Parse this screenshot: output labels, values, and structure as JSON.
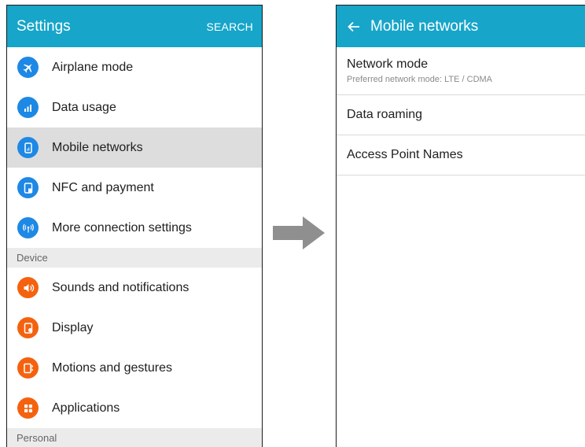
{
  "left_screen": {
    "app_bar": {
      "title": "Settings",
      "search_label": "SEARCH",
      "color": "#17a5c9"
    },
    "items": [
      {
        "label": "Airplane mode",
        "icon": "airplane-icon",
        "color": "#1e88e5"
      },
      {
        "label": "Data usage",
        "icon": "bar-chart-icon",
        "color": "#1e88e5"
      },
      {
        "label": "Mobile networks",
        "icon": "mobile-network-icon",
        "color": "#1e88e5",
        "selected": true
      },
      {
        "label": "NFC and payment",
        "icon": "nfc-icon",
        "color": "#1e88e5"
      },
      {
        "label": "More connection settings",
        "icon": "wireless-icon",
        "color": "#1e88e5"
      }
    ],
    "section_device": "Device",
    "device_items": [
      {
        "label": "Sounds and notifications",
        "icon": "speaker-icon",
        "color": "#f4620f"
      },
      {
        "label": "Display",
        "icon": "display-icon",
        "color": "#f4620f"
      },
      {
        "label": "Motions and gestures",
        "icon": "motion-icon",
        "color": "#f4620f"
      },
      {
        "label": "Applications",
        "icon": "apps-grid-icon",
        "color": "#f4620f"
      }
    ],
    "section_personal": "Personal"
  },
  "right_screen": {
    "app_bar": {
      "back_icon": "back-arrow-icon",
      "title": "Mobile networks",
      "color": "#17a5c9"
    },
    "items": [
      {
        "title": "Network mode",
        "subtitle": "Preferred network mode: LTE / CDMA"
      },
      {
        "title": "Data roaming"
      },
      {
        "title": "Access Point Names"
      }
    ]
  },
  "transition_arrow": {
    "icon": "right-arrow-icon",
    "color": "#8f8f8f"
  }
}
